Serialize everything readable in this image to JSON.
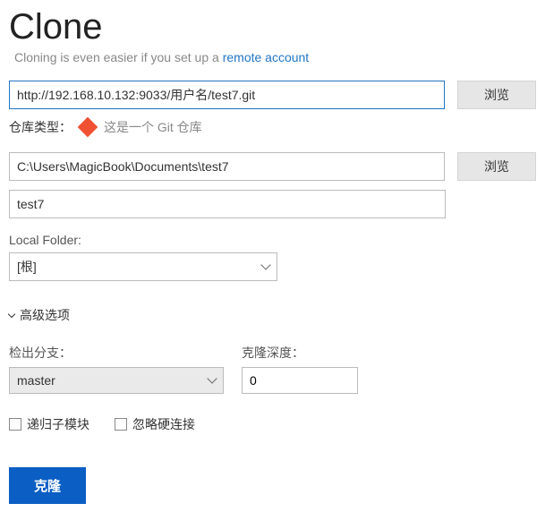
{
  "title": "Clone",
  "subtitle_prefix": "Cloning is even easier if you set up a ",
  "subtitle_link": "remote account",
  "source_url": "http://192.168.10.132:9033/用户名/test7.git",
  "browse_label": "浏览",
  "repo_type": {
    "label": "仓库类型：",
    "text": "这是一个 Git 仓库"
  },
  "dest_path": "C:\\Users\\MagicBook\\Documents\\test7",
  "name": "test7",
  "local_folder": {
    "label": "Local Folder:",
    "selected": "[根]"
  },
  "advanced_label": "高级选项",
  "checkout_branch": {
    "label": "检出分支：",
    "selected": "master"
  },
  "clone_depth": {
    "label": "克隆深度：",
    "value": "0"
  },
  "checkboxes": {
    "recurse": "递归子模块",
    "no_hardlinks": "忽略硬连接"
  },
  "clone_button": "克隆"
}
